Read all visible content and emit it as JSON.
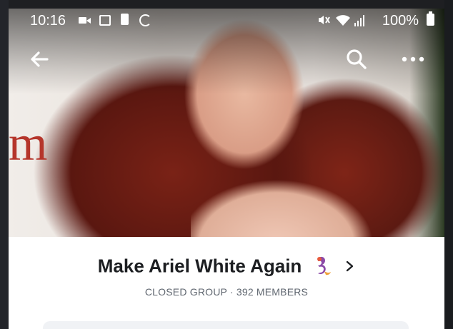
{
  "status_bar": {
    "time": "10:16",
    "battery_percent": "100%",
    "icons": [
      "video-icon",
      "image-icon",
      "battery-saver-icon",
      "sync-icon",
      "mute-icon",
      "wifi-icon",
      "signal-icon",
      "battery-icon"
    ]
  },
  "nav": {
    "back_icon": "arrow-left-icon",
    "search_icon": "search-icon",
    "more_icon": "more-horizontal-icon"
  },
  "group": {
    "name": "Make Ariel White Again",
    "emoji": "mermaid-emoji",
    "meta": "CLOSED GROUP · 392 MEMBERS"
  },
  "colors": {
    "title_text": "#1c1e21",
    "meta_text": "#606770",
    "background": "#ffffff"
  }
}
